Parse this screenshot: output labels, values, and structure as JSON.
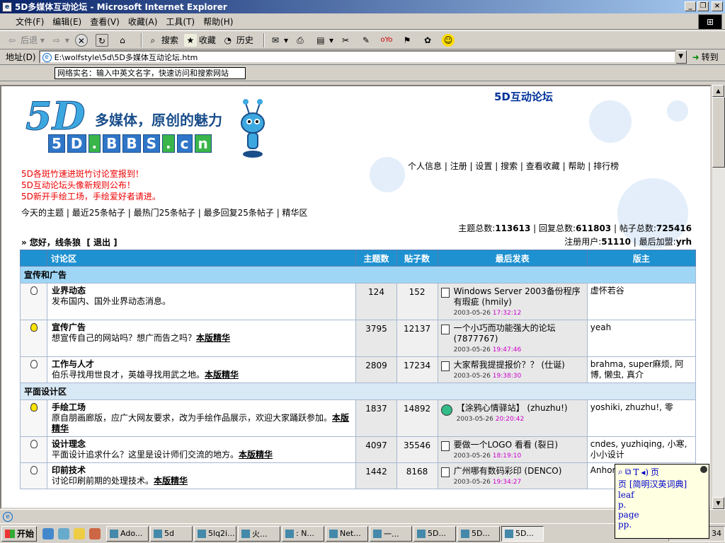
{
  "window": {
    "title": "5D多媒体互动论坛 - Microsoft Internet Explorer"
  },
  "menu": [
    "文件(F)",
    "编辑(E)",
    "查看(V)",
    "收藏(A)",
    "工具(T)",
    "帮助(H)"
  ],
  "toolbar": {
    "back": "后退",
    "forward": "",
    "search": "搜索",
    "favorites": "收藏",
    "history": "历史"
  },
  "address": {
    "label": "地址(D)",
    "value": "E:\\wolfstyle\\5d\\5D多媒体互动论坛.htm",
    "go": "转到"
  },
  "realname": {
    "placeholder": "网络实名：输入中英文名字，快速访问和搜索网站"
  },
  "page": {
    "forum_title": "5D互动论坛",
    "logo": {
      "brand": "5D",
      "slogan": "多媒体，原创的魅力",
      "url_chars": [
        "5",
        "D",
        ".",
        "B",
        "B",
        "S",
        ".",
        "c",
        "n"
      ]
    },
    "top_links": [
      "个人信息",
      "注册",
      "设置",
      "搜索",
      "查看收藏",
      "帮助",
      "排行榜"
    ],
    "announcements": [
      "5D各斑竹速进斑竹讨论室报到！",
      "5D互动论坛头像新规则公布！",
      "5D新开手绘工场，手绘爱好者请进。"
    ],
    "quick_links": [
      "今天的主题",
      "最近25条帖子",
      "最热门25条帖子",
      "最多回复25条帖子",
      "精华区"
    ],
    "stats": {
      "topics_label": "主题总数:",
      "topics": "113613",
      "replies_label": "回复总数:",
      "replies": "611803",
      "posts_label": "帖子总数:",
      "posts": "725416",
      "users_label": "注册用户:",
      "users": "51110",
      "newest_label": "最后加盟:",
      "newest": "yrh"
    },
    "greeting": {
      "prefix": "» 您好，",
      "user": "线条狼",
      "logout": "[ 退出 ]"
    },
    "table_headers": [
      "讨论区",
      "主题数",
      "贴子数",
      "最后发表",
      "版主"
    ],
    "best_label": "本版精华",
    "categories": [
      {
        "name": "宣传和广告",
        "forums": [
          {
            "name": "业界动态",
            "desc": "发布国内、国外业界动态消息。",
            "best": false,
            "topics": "124",
            "posts": "152",
            "last_title": "Windows Server 2003备份程序有瑕疵",
            "last_user": "(hmily)",
            "last_date": "2003-05-26",
            "last_time": "17:32:12",
            "mods": "虚怀若谷",
            "bulb_on": false
          },
          {
            "name": "宣传广告",
            "desc": "想宣传自己的网站吗？想广而告之吗？",
            "best": true,
            "topics": "3795",
            "posts": "12137",
            "last_title": "一个小巧而功能强大的论坛",
            "last_user": "(7877767)",
            "last_date": "2003-05-26",
            "last_time": "19:47:46",
            "mods": "yeah",
            "bulb_on": true
          },
          {
            "name": "工作与人才",
            "desc": "伯乐寻找用世良才，英雄寻找用武之地。",
            "best": true,
            "topics": "2809",
            "posts": "17234",
            "last_title": "大家帮我提提报价？？",
            "last_user": "(仕诞)",
            "last_date": "2003-05-26",
            "last_time": "19:38:30",
            "mods": "brahma, super麻烦, 阿博, 懒虫, 真介",
            "bulb_on": false
          }
        ]
      },
      {
        "name": "平面设计区",
        "forums": [
          {
            "name": "手绘工场",
            "desc": "原自朋画廊版，应广大网友要求，改为手绘作品展示，欢迎大家踊跃参加。",
            "best": true,
            "topics": "1837",
            "posts": "14892",
            "last_title": "【涂鸦心情驿站】",
            "last_user": "(zhuzhu!)",
            "last_date": "2003-05-26",
            "last_time": "20:20:42",
            "mods": "yoshiki, zhuzhu!, 零",
            "bulb_on": true
          },
          {
            "name": "设计理念",
            "desc": "平面设计追求什么？这里是设计师们交流的地方。",
            "best": true,
            "topics": "4097",
            "posts": "35546",
            "last_title": "要做一个LOGO 看看",
            "last_user": "(裂日)",
            "last_date": "2003-05-26",
            "last_time": "18:19:10",
            "mods": "cndes, yuzhiqing, 小寒, 小小设计",
            "bulb_on": false
          },
          {
            "name": "印前技术",
            "desc": "讨论印刷前期的处理技术。",
            "best": true,
            "topics": "1442",
            "posts": "8168",
            "last_title": "广州哪有数码彩印",
            "last_user": "(DENCO)",
            "last_date": "2003-05-26",
            "last_time": "19:34:27",
            "mods": "Anhon",
            "bulb_on": false
          }
        ]
      }
    ]
  },
  "dict": {
    "word": "页",
    "title": "页 [简明汉英词典]",
    "lines": [
      "leaf",
      "p.",
      "page",
      "pp."
    ]
  },
  "taskbar": {
    "start": "开始",
    "tasks": [
      "Ado...",
      "5d",
      "5lq2i...",
      "火...",
      ": N...",
      "Net...",
      "一...",
      "5D...",
      "5D...",
      "5D..."
    ],
    "clock": "34"
  }
}
